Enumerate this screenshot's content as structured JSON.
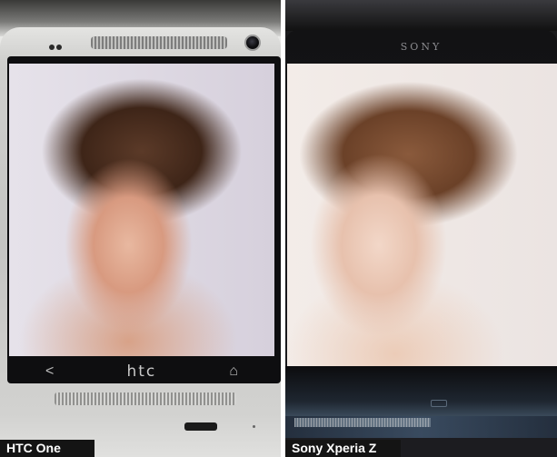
{
  "left_panel": {
    "caption": "HTC One",
    "navbar": {
      "back_glyph": "<",
      "brand": "htc",
      "home_glyph": "⌂"
    }
  },
  "right_panel": {
    "caption": "Sony Xperia Z",
    "brand": "SONY"
  },
  "colors": {
    "caption_bg": "#141414",
    "caption_text": "#ffffff",
    "htc_silver": "#c4c4c2",
    "sony_black": "#1a1a1c"
  },
  "icons": [
    "back-icon",
    "home-icon",
    "camera-icon"
  ]
}
